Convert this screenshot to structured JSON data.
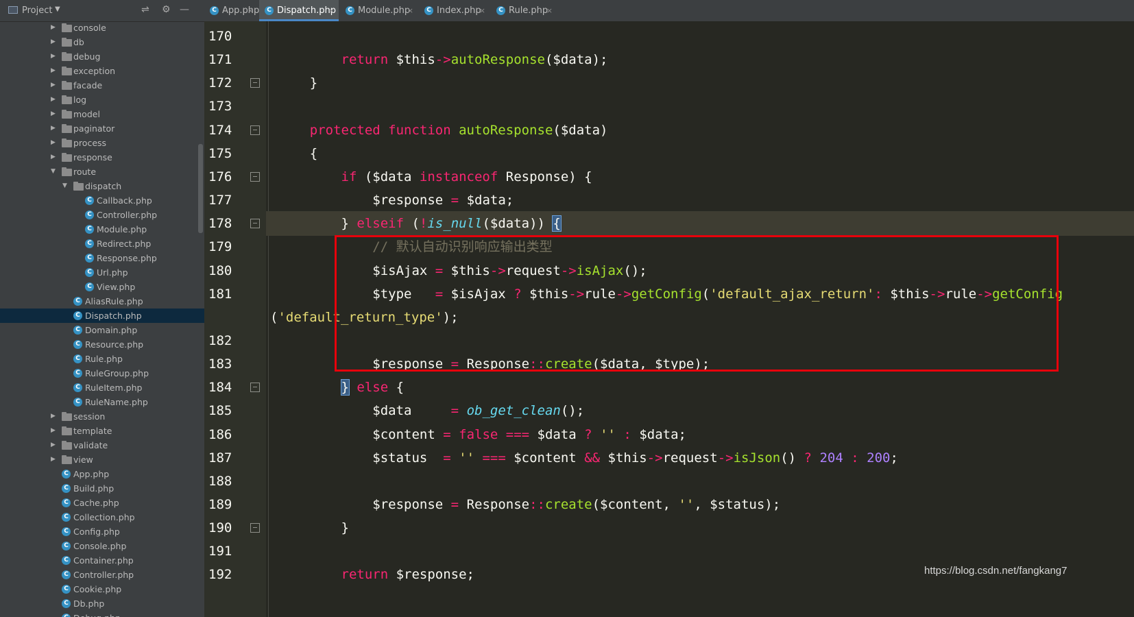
{
  "project_panel": {
    "title": "Project",
    "tree": [
      {
        "label": "console",
        "type": "folder",
        "depth": 1
      },
      {
        "label": "db",
        "type": "folder",
        "depth": 1
      },
      {
        "label": "debug",
        "type": "folder",
        "depth": 1
      },
      {
        "label": "exception",
        "type": "folder",
        "depth": 1
      },
      {
        "label": "facade",
        "type": "folder",
        "depth": 1
      },
      {
        "label": "log",
        "type": "folder",
        "depth": 1
      },
      {
        "label": "model",
        "type": "folder",
        "depth": 1
      },
      {
        "label": "paginator",
        "type": "folder",
        "depth": 1
      },
      {
        "label": "process",
        "type": "folder",
        "depth": 1
      },
      {
        "label": "response",
        "type": "folder",
        "depth": 1
      },
      {
        "label": "route",
        "type": "folder-open",
        "depth": 1
      },
      {
        "label": "dispatch",
        "type": "folder-open",
        "depth": 2
      },
      {
        "label": "Callback.php",
        "type": "file",
        "depth": 3
      },
      {
        "label": "Controller.php",
        "type": "file",
        "depth": 3
      },
      {
        "label": "Module.php",
        "type": "file",
        "depth": 3
      },
      {
        "label": "Redirect.php",
        "type": "file",
        "depth": 3
      },
      {
        "label": "Response.php",
        "type": "file",
        "depth": 3
      },
      {
        "label": "Url.php",
        "type": "file",
        "depth": 3
      },
      {
        "label": "View.php",
        "type": "file",
        "depth": 3
      },
      {
        "label": "AliasRule.php",
        "type": "file",
        "depth": 2
      },
      {
        "label": "Dispatch.php",
        "type": "file",
        "depth": 2,
        "selected": true
      },
      {
        "label": "Domain.php",
        "type": "file",
        "depth": 2
      },
      {
        "label": "Resource.php",
        "type": "file",
        "depth": 2
      },
      {
        "label": "Rule.php",
        "type": "file",
        "depth": 2
      },
      {
        "label": "RuleGroup.php",
        "type": "file",
        "depth": 2
      },
      {
        "label": "RuleItem.php",
        "type": "file",
        "depth": 2
      },
      {
        "label": "RuleName.php",
        "type": "file",
        "depth": 2
      },
      {
        "label": "session",
        "type": "folder",
        "depth": 1
      },
      {
        "label": "template",
        "type": "folder",
        "depth": 1
      },
      {
        "label": "validate",
        "type": "folder",
        "depth": 1
      },
      {
        "label": "view",
        "type": "folder",
        "depth": 1
      },
      {
        "label": "App.php",
        "type": "file",
        "depth": 1
      },
      {
        "label": "Build.php",
        "type": "file",
        "depth": 1
      },
      {
        "label": "Cache.php",
        "type": "file",
        "depth": 1
      },
      {
        "label": "Collection.php",
        "type": "file",
        "depth": 1
      },
      {
        "label": "Config.php",
        "type": "file",
        "depth": 1
      },
      {
        "label": "Console.php",
        "type": "file",
        "depth": 1
      },
      {
        "label": "Container.php",
        "type": "file",
        "depth": 1
      },
      {
        "label": "Controller.php",
        "type": "file",
        "depth": 1
      },
      {
        "label": "Cookie.php",
        "type": "file",
        "depth": 1
      },
      {
        "label": "Db.php",
        "type": "file",
        "depth": 1
      },
      {
        "label": "Debug.php",
        "type": "file",
        "depth": 1
      }
    ]
  },
  "tabs": [
    {
      "label": "App.php",
      "active": false
    },
    {
      "label": "Dispatch.php",
      "active": true
    },
    {
      "label": "Module.php",
      "active": false
    },
    {
      "label": "Index.php",
      "active": false
    },
    {
      "label": "Rule.php",
      "active": false
    }
  ],
  "editor": {
    "current_line": "178",
    "lines": [
      {
        "num": "170",
        "tokens": []
      },
      {
        "num": "171",
        "tokens": [
          [
            "kw",
            "        return "
          ],
          [
            "",
            "$this"
          ],
          [
            "op",
            "->"
          ],
          [
            "fn",
            "autoResponse"
          ],
          [
            "",
            "($data);"
          ]
        ]
      },
      {
        "num": "172",
        "tokens": [
          [
            "",
            "    }"
          ]
        ]
      },
      {
        "num": "173",
        "tokens": []
      },
      {
        "num": "174",
        "tokens": [
          [
            "kw",
            "    protected "
          ],
          [
            "kw",
            "function "
          ],
          [
            "fn",
            "autoResponse"
          ],
          [
            "",
            "($data)"
          ]
        ]
      },
      {
        "num": "175",
        "tokens": [
          [
            "",
            "    {"
          ]
        ]
      },
      {
        "num": "176",
        "tokens": [
          [
            "kw",
            "        if "
          ],
          [
            "",
            "($data "
          ],
          [
            "kw",
            "instanceof "
          ],
          [
            "",
            "Response) {"
          ]
        ]
      },
      {
        "num": "177",
        "tokens": [
          [
            "",
            "            $response "
          ],
          [
            "op",
            "="
          ],
          [
            "",
            " $data;"
          ]
        ]
      },
      {
        "num": "178",
        "tokens": [
          [
            "",
            "        } "
          ],
          [
            "kw",
            "elseif "
          ],
          [
            "",
            "("
          ],
          [
            "op",
            "!"
          ],
          [
            "it",
            "is_null"
          ],
          [
            "",
            "($data)) "
          ],
          [
            "hl",
            "{"
          ]
        ]
      },
      {
        "num": "179",
        "tokens": [
          [
            "cmt",
            "            // 默认自动识别响应输出类型"
          ]
        ]
      },
      {
        "num": "180",
        "tokens": [
          [
            "",
            "            $isAjax "
          ],
          [
            "op",
            "="
          ],
          [
            "",
            " $this"
          ],
          [
            "op",
            "->"
          ],
          [
            "",
            "request"
          ],
          [
            "op",
            "->"
          ],
          [
            "fn",
            "isAjax"
          ],
          [
            "",
            "();"
          ]
        ]
      },
      {
        "num": "181",
        "tokens": [
          [
            "",
            "            $type   "
          ],
          [
            "op",
            "="
          ],
          [
            "",
            " $isAjax "
          ],
          [
            "op",
            "?"
          ],
          [
            "",
            " $this"
          ],
          [
            "op",
            "->"
          ],
          [
            "",
            "rule"
          ],
          [
            "op",
            "->"
          ],
          [
            "fn",
            "getConfig"
          ],
          [
            "",
            "("
          ],
          [
            "str",
            "'default_ajax_return'"
          ],
          [
            ") "
          ],
          [
            "op",
            ":"
          ],
          [
            "",
            " $this"
          ],
          [
            "op",
            "->"
          ],
          [
            "",
            "rule"
          ],
          [
            "op",
            "->"
          ],
          [
            "fn",
            "getConfig"
          ]
        ]
      },
      {
        "num": "",
        "tokens": [
          [
            "",
            "("
          ],
          [
            "str",
            "'default_return_type'"
          ],
          [
            "",
            ");"
          ]
        ]
      },
      {
        "num": "182",
        "tokens": []
      },
      {
        "num": "183",
        "tokens": [
          [
            "",
            "            $response "
          ],
          [
            "op",
            "="
          ],
          [
            "",
            " Response"
          ],
          [
            "op",
            "::"
          ],
          [
            "fn",
            "create"
          ],
          [
            "",
            "($data, $type);"
          ]
        ]
      },
      {
        "num": "184",
        "tokens": [
          [
            "",
            "        "
          ],
          [
            "hl",
            "}"
          ],
          [
            "",
            " "
          ],
          [
            "kw",
            "else "
          ],
          [
            "",
            "{"
          ]
        ]
      },
      {
        "num": "185",
        "tokens": [
          [
            "",
            "            $data     "
          ],
          [
            "op",
            "="
          ],
          [
            "",
            " "
          ],
          [
            "it",
            "ob_get_clean"
          ],
          [
            "",
            "();"
          ]
        ]
      },
      {
        "num": "186",
        "tokens": [
          [
            "",
            "            $content "
          ],
          [
            "op",
            "="
          ],
          [
            "",
            " "
          ],
          [
            "kw",
            "false "
          ],
          [
            "op",
            "==="
          ],
          [
            "",
            " $data "
          ],
          [
            "op",
            "?"
          ],
          [
            "",
            " "
          ],
          [
            "str",
            "''"
          ],
          [
            "",
            " "
          ],
          [
            "op",
            ":"
          ],
          [
            "",
            " $data;"
          ]
        ]
      },
      {
        "num": "187",
        "tokens": [
          [
            "",
            "            $status  "
          ],
          [
            "op",
            "="
          ],
          [
            "",
            " "
          ],
          [
            "str",
            "''"
          ],
          [
            "",
            " "
          ],
          [
            "op",
            "==="
          ],
          [
            "",
            " $content "
          ],
          [
            "op",
            "&&"
          ],
          [
            "",
            " $this"
          ],
          [
            "op",
            "->"
          ],
          [
            "",
            "request"
          ],
          [
            "op",
            "->"
          ],
          [
            "fn",
            "isJson"
          ],
          [
            "",
            "() "
          ],
          [
            "op",
            "?"
          ],
          [
            "",
            " "
          ],
          [
            "num",
            "204"
          ],
          [
            "",
            " "
          ],
          [
            "op",
            ":"
          ],
          [
            "",
            " "
          ],
          [
            "num",
            "200"
          ],
          [
            "",
            ";"
          ]
        ]
      },
      {
        "num": "188",
        "tokens": []
      },
      {
        "num": "189",
        "tokens": [
          [
            "",
            "            $response "
          ],
          [
            "op",
            "="
          ],
          [
            "",
            " Response"
          ],
          [
            "op",
            "::"
          ],
          [
            "fn",
            "create"
          ],
          [
            "",
            "($content, "
          ],
          [
            "str",
            "''"
          ],
          [
            "",
            ", $status);"
          ]
        ]
      },
      {
        "num": "190",
        "tokens": [
          [
            "",
            "        }"
          ]
        ]
      },
      {
        "num": "191",
        "tokens": []
      },
      {
        "num": "192",
        "tokens": [
          [
            "kw",
            "        return "
          ],
          [
            "",
            "$response;"
          ]
        ]
      }
    ]
  },
  "watermark": "https://blog.csdn.net/fangkang7",
  "colors": {
    "accent_tab": "#4a88c7",
    "highlight_box": "#e8000b",
    "keyword": "#f92672",
    "function": "#a6e22e",
    "string": "#e6db74",
    "number": "#ae81ff",
    "comment": "#75715e"
  },
  "icons": {
    "browser_icons": [
      "chrome-icon",
      "edge-icon",
      "firefox-icon",
      "browser-icon"
    ]
  }
}
